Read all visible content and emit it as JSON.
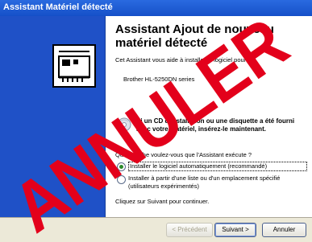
{
  "window": {
    "title": "Assistant Matériel détecté"
  },
  "content": {
    "heading": "Assistant Ajout de nouveau matériel détecté",
    "intro": "Cet Assistant vous aide à installer le logiciel pour :",
    "device": "Brother HL-5250DN series",
    "note": "Si un CD d'installation ou une disquette a été fourni avec votre matériel, insérez-le maintenant.",
    "question": "Quelle tâche voulez-vous que l'Assistant exécute ?",
    "options": [
      {
        "label": "Installer le logiciel automatiquement (recommandé)",
        "selected": true
      },
      {
        "label": "Installer à partir d'une liste ou d'un emplacement spécifié (utilisateurs expérimentés)",
        "selected": false
      }
    ],
    "footer": "Cliquez sur Suivant pour continuer."
  },
  "buttons": {
    "back": "< Précédent",
    "next": "Suivant >",
    "cancel": "Annuler"
  },
  "watermark": {
    "text": "ANNULER",
    "color": "#e3001b"
  },
  "colors": {
    "sidebar": "#1f51c7",
    "titlebar": "#1550c8"
  }
}
